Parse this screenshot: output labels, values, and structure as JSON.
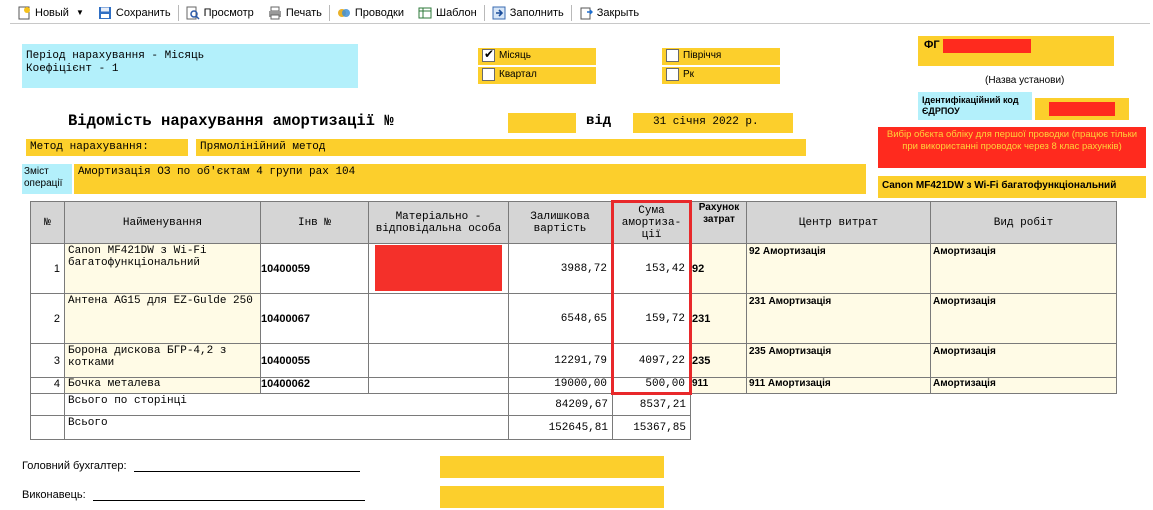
{
  "toolbar": {
    "new": "Новый",
    "save": "Сохранить",
    "preview": "Просмотр",
    "print": "Печать",
    "postings": "Проводки",
    "template": "Шаблон",
    "fill": "Заполнить",
    "close": "Закрыть"
  },
  "period": {
    "line1": "Період нарахування - Місяць",
    "line2": "Коефіцієнт - 1"
  },
  "period_options": {
    "month": "Місяць",
    "quarter": "Квартал",
    "half_year": "Півріччя",
    "year": "Рк",
    "month_checked": true
  },
  "org": {
    "prefix": "ФГ",
    "name_caption": "(Назва установи)",
    "edrpou_label": "Ідентифікаційний код ЄДРПОУ"
  },
  "doc": {
    "title": "Відомість нарахування амортизації №",
    "number": "",
    "from_label": "від",
    "date": "31 січня 2022 р."
  },
  "method": {
    "label": "Метод нарахування:",
    "value": "Прямолінійний метод"
  },
  "notice": "Вибір обєкта обліку для першої проводки (працює тільки при використанні проводок через 8 клас рахунків)",
  "content": {
    "label": "Зміст операції",
    "value": "Амортизація ОЗ по об'єктам 4 групи рах 104"
  },
  "object_selected": "Canon MF421DW з Wi-Fi багатофункціональний",
  "table": {
    "headers": {
      "no": "№",
      "name": "Найменування",
      "inv": "Інв №",
      "person": "Матеріально - відповідальна особа",
      "residual": "Залишкова вартість",
      "amount": "Сума амортиза-ції",
      "account": "Рахунок затрат",
      "cost_center": "Центр витрат",
      "work_type": "Вид робіт"
    },
    "rows": [
      {
        "no": "1",
        "name": "Canon MF421DW з Wi-Fi багатофункціональний",
        "inv": "10400059",
        "residual": "3988,72",
        "amount": "153,42",
        "account": "92",
        "cost_center": "92 Амортизація",
        "work_type": "Амортизація"
      },
      {
        "no": "2",
        "name": "Антена AG15 для EZ-Gulde 250",
        "inv": "10400067",
        "residual": "6548,65",
        "amount": "159,72",
        "account": "231",
        "cost_center": "231 Амортизація",
        "work_type": "Амортизація"
      },
      {
        "no": "3",
        "name": "Борона дискова БГР-4,2 з котками",
        "inv": "10400055",
        "residual": "12291,79",
        "amount": "4097,22",
        "account": "235",
        "cost_center": "235 Амортизація",
        "work_type": "Амортизація"
      },
      {
        "no": "4",
        "name": "Бочка металева",
        "inv": "10400062",
        "residual": "19000,00",
        "amount": "500,00",
        "account": "911",
        "cost_center": "911 Амортизація",
        "work_type": "Амортизація"
      }
    ],
    "page_total": {
      "label": "Всього по сторінці",
      "residual": "84209,67",
      "amount": "8537,21"
    },
    "total": {
      "label": "Всього",
      "residual": "152645,81",
      "amount": "15367,85"
    }
  },
  "signatures": {
    "chief_accountant": "Головний бухгалтер:",
    "executor": "Виконавець:"
  },
  "colors": {
    "cyan": "#b3f0fb",
    "yellow": "#fccf2c",
    "red": "#ff2a1e",
    "highlight_border": "#e8282a",
    "header_gray": "#d5d5d5"
  }
}
